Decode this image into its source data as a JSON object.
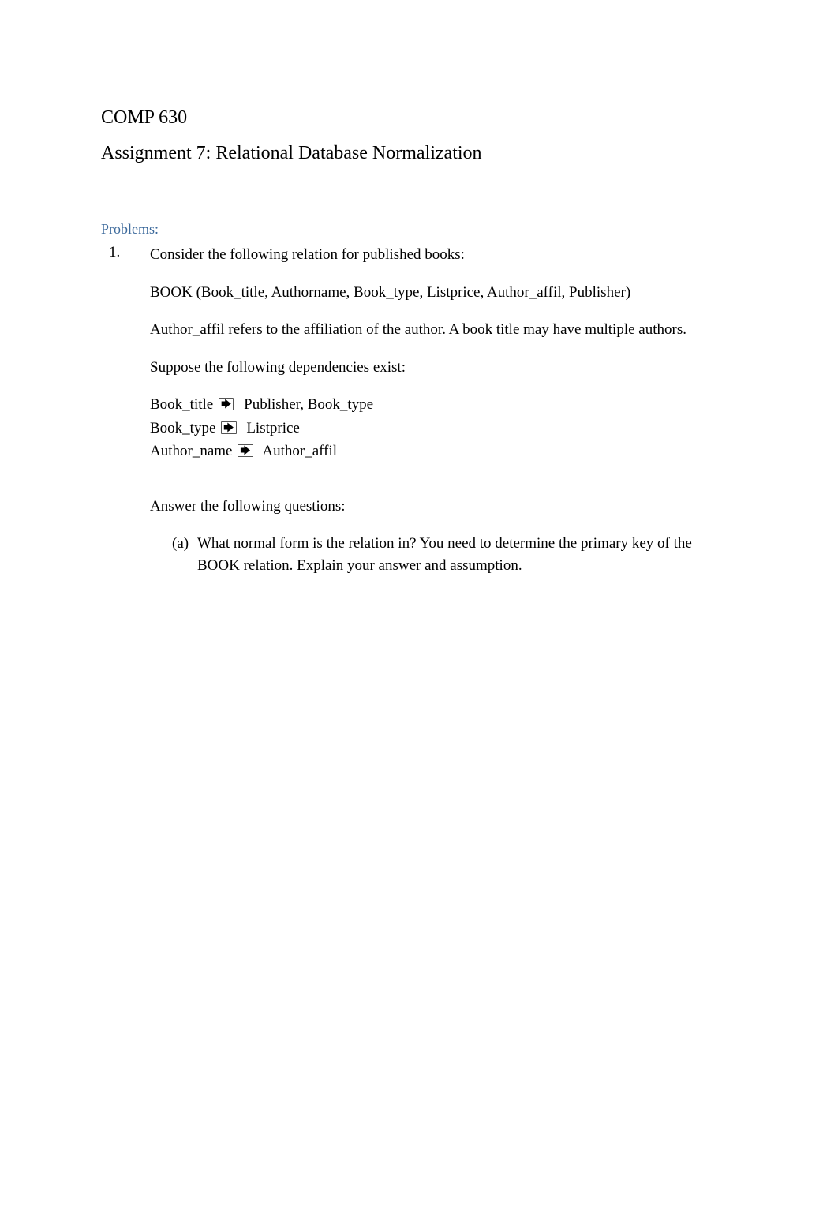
{
  "course_code": "COMP 630",
  "assignment_title": "Assignment 7: Relational Database Normalization",
  "section_heading": "Problems:",
  "problem": {
    "number": "1.",
    "intro": "Consider the following relation for published books:",
    "relation": "BOOK (Book_title, Authorname, Book_type, Listprice, Author_affil, Publisher)",
    "affil_note": "Author_affil refers to the affiliation of the author. A book title may have multiple authors.",
    "suppose": "Suppose the following dependencies exist:",
    "dep1_left": "Book_title",
    "dep1_right": "  Publisher, Book_type",
    "dep2_left": "Book_type",
    "dep2_right": "  Listprice",
    "dep3_left": "Author_name",
    "dep3_right": "  Author_affil",
    "answer_intro": "Answer the following questions:",
    "sub_a_marker": "(a)",
    "sub_a_text": "What normal form is the relation in? You need to determine the primary key of the BOOK relation. Explain your answer and assumption."
  },
  "arrow_glyph": "🡆"
}
